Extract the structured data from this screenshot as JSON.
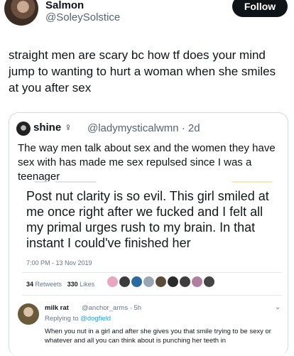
{
  "tweet": {
    "author_name": "Salmon",
    "author_handle": "@SoleySolstice",
    "follow_label": "Follow",
    "text": "straight men are scary bc how tf does your mind jump to wanting to hurt a woman when she smiles at you after sex"
  },
  "quote": {
    "name": "shine ♀",
    "handle": "@ladymysticalwmn · 2d",
    "text": "The way men talk about sex and the women they have sex with has made me sex repulsed since I was a teenager"
  },
  "embedded": {
    "text": "Post nut clarity is so evil. This girl smiled at me once right after we fucked and I felt all my primal urges rush to my brain. In that instant I could've finished her",
    "timestamp": "7:00 PM - 13 Nov 2019",
    "retweets_count": "34",
    "retweets_label": "Retweets",
    "likes_count": "330",
    "likes_label": "Likes",
    "liker_colors": [
      "#e9a6c0",
      "#3b3b3b",
      "#2b6aa0",
      "#9aa6b2",
      "#5a4a3a",
      "#2a2a2a",
      "#3d3d3d",
      "#b07fa0",
      "#444444"
    ],
    "reply": {
      "name": "milk rat",
      "meta": "@anchor_arms · 5h",
      "replying_prefix": "Replying to",
      "replying_handle": "@dogfield",
      "text": "When you nut in a girl and after she gives you that smile trying to be sexy or whatever and all you can think about is punching her teeth in"
    }
  }
}
